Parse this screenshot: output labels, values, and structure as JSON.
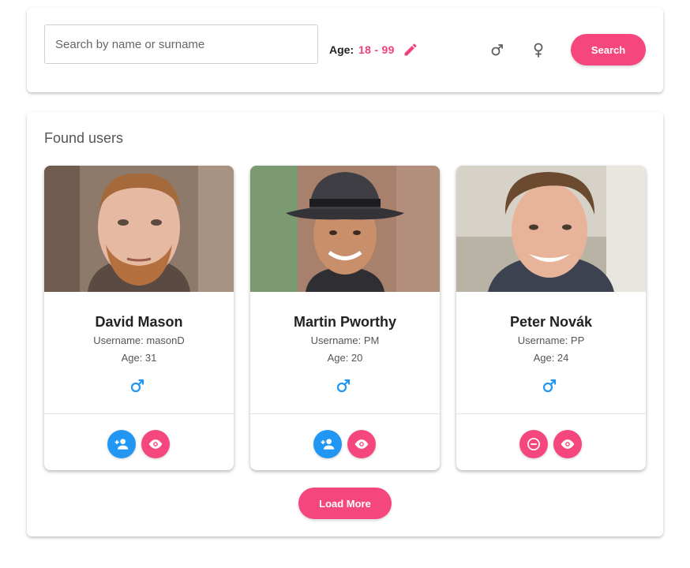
{
  "search": {
    "placeholder": "Search by name or surname",
    "value": "",
    "age_label": "Age:",
    "age_range": "18 - 99",
    "button_label": "Search"
  },
  "results": {
    "title": "Found users",
    "load_more_label": "Load More",
    "users": [
      {
        "name": "David Mason",
        "username": "Username: masonD",
        "age": "Age: 31",
        "gender": "male",
        "action": "add-friend"
      },
      {
        "name": "Martin Pworthy",
        "username": "Username: PM",
        "age": "Age: 20",
        "gender": "male",
        "action": "add-friend"
      },
      {
        "name": "Peter Novák",
        "username": "Username: PP",
        "age": "Age: 24",
        "gender": "male",
        "action": "remove-friend"
      }
    ]
  },
  "colors": {
    "accent_pink": "#f5467e",
    "age_pink": "#f0417a",
    "male_blue": "#2196f3",
    "icon_gray": "#616161"
  },
  "icons": {
    "edit": "pencil-icon",
    "male": "male-symbol-icon",
    "female": "female-symbol-icon",
    "add_friend": "person-add-icon",
    "remove_friend": "minus-circle-icon",
    "view": "eye-icon"
  }
}
